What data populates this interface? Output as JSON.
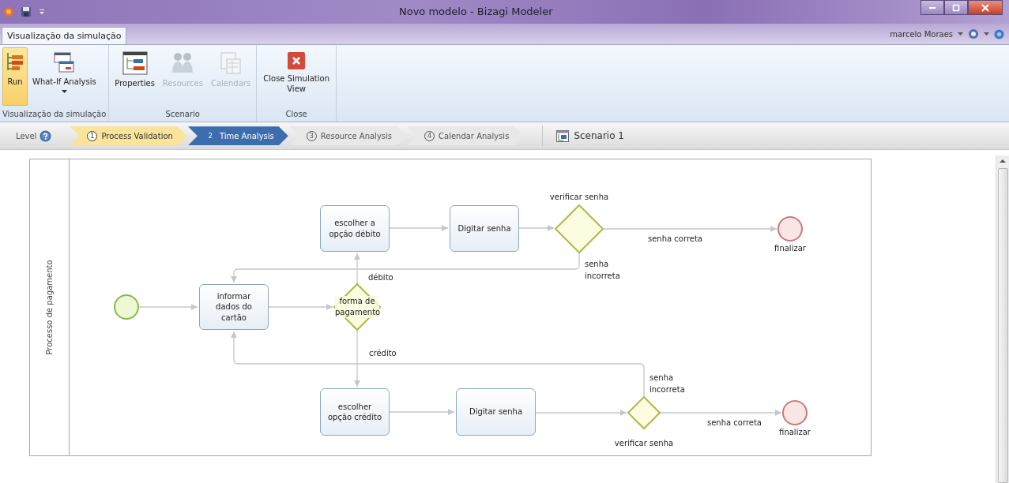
{
  "window": {
    "title": "Novo modelo - Bizagi Modeler"
  },
  "ribbon": {
    "tab": {
      "label": "Visualização da simulação",
      "selected": true
    },
    "user": "marcelo Moraes",
    "groups": [
      {
        "label": "Visualização da simulação",
        "buttons": [
          {
            "kind": "run",
            "label": "Run",
            "selected": true,
            "disabled": false,
            "dropdown": false
          },
          {
            "kind": "whatif",
            "label": "What-If Analysis",
            "selected": false,
            "disabled": false,
            "dropdown": true
          }
        ]
      },
      {
        "label": "Scenario",
        "buttons": [
          {
            "kind": "properties",
            "label": "Properties",
            "selected": false,
            "disabled": false,
            "dropdown": false
          },
          {
            "kind": "resources",
            "label": "Resources",
            "selected": false,
            "disabled": true,
            "dropdown": false
          },
          {
            "kind": "calendars",
            "label": "Calendars",
            "selected": false,
            "disabled": true,
            "dropdown": false
          }
        ]
      },
      {
        "label": "Close",
        "buttons": [
          {
            "kind": "close",
            "label": "Close Simulation View",
            "selected": false,
            "disabled": false,
            "dropdown": false
          }
        ]
      }
    ]
  },
  "level": {
    "label": "Level",
    "steps": [
      {
        "number": "1",
        "label": "Process Validation",
        "completed": true,
        "selected": false
      },
      {
        "number": "2",
        "label": "Time Analysis",
        "completed": false,
        "selected": true
      },
      {
        "number": "3",
        "label": "Resource Analysis",
        "completed": false,
        "selected": false
      },
      {
        "number": "4",
        "label": "Calendar Analysis",
        "completed": false,
        "selected": false
      }
    ]
  },
  "scenario": "Scenario 1",
  "diagram": {
    "lane": "Processo de pagamento",
    "nodes": [
      {
        "kind": "task",
        "label": "escolher a opção débito"
      },
      {
        "kind": "task",
        "label": "Digitar senha"
      },
      {
        "kind": "gateway",
        "label": "verificar senha"
      },
      {
        "kind": "end",
        "label": "finalizar"
      },
      {
        "kind": "start"
      },
      {
        "kind": "task",
        "label": "informar dados do cartão"
      },
      {
        "kind": "gateway",
        "label": "forma de pagamento"
      },
      {
        "kind": "task",
        "label": "escolher opção crédito"
      },
      {
        "kind": "task",
        "label": "Digitar senha"
      },
      {
        "kind": "gateway",
        "label": "verificar senha"
      },
      {
        "kind": "end",
        "label": "finalizar"
      }
    ],
    "flow_labels": [
      "débito",
      "crédito",
      "senha correta",
      "senha incorreta",
      "senha correta",
      "senha incorreta"
    ]
  }
}
